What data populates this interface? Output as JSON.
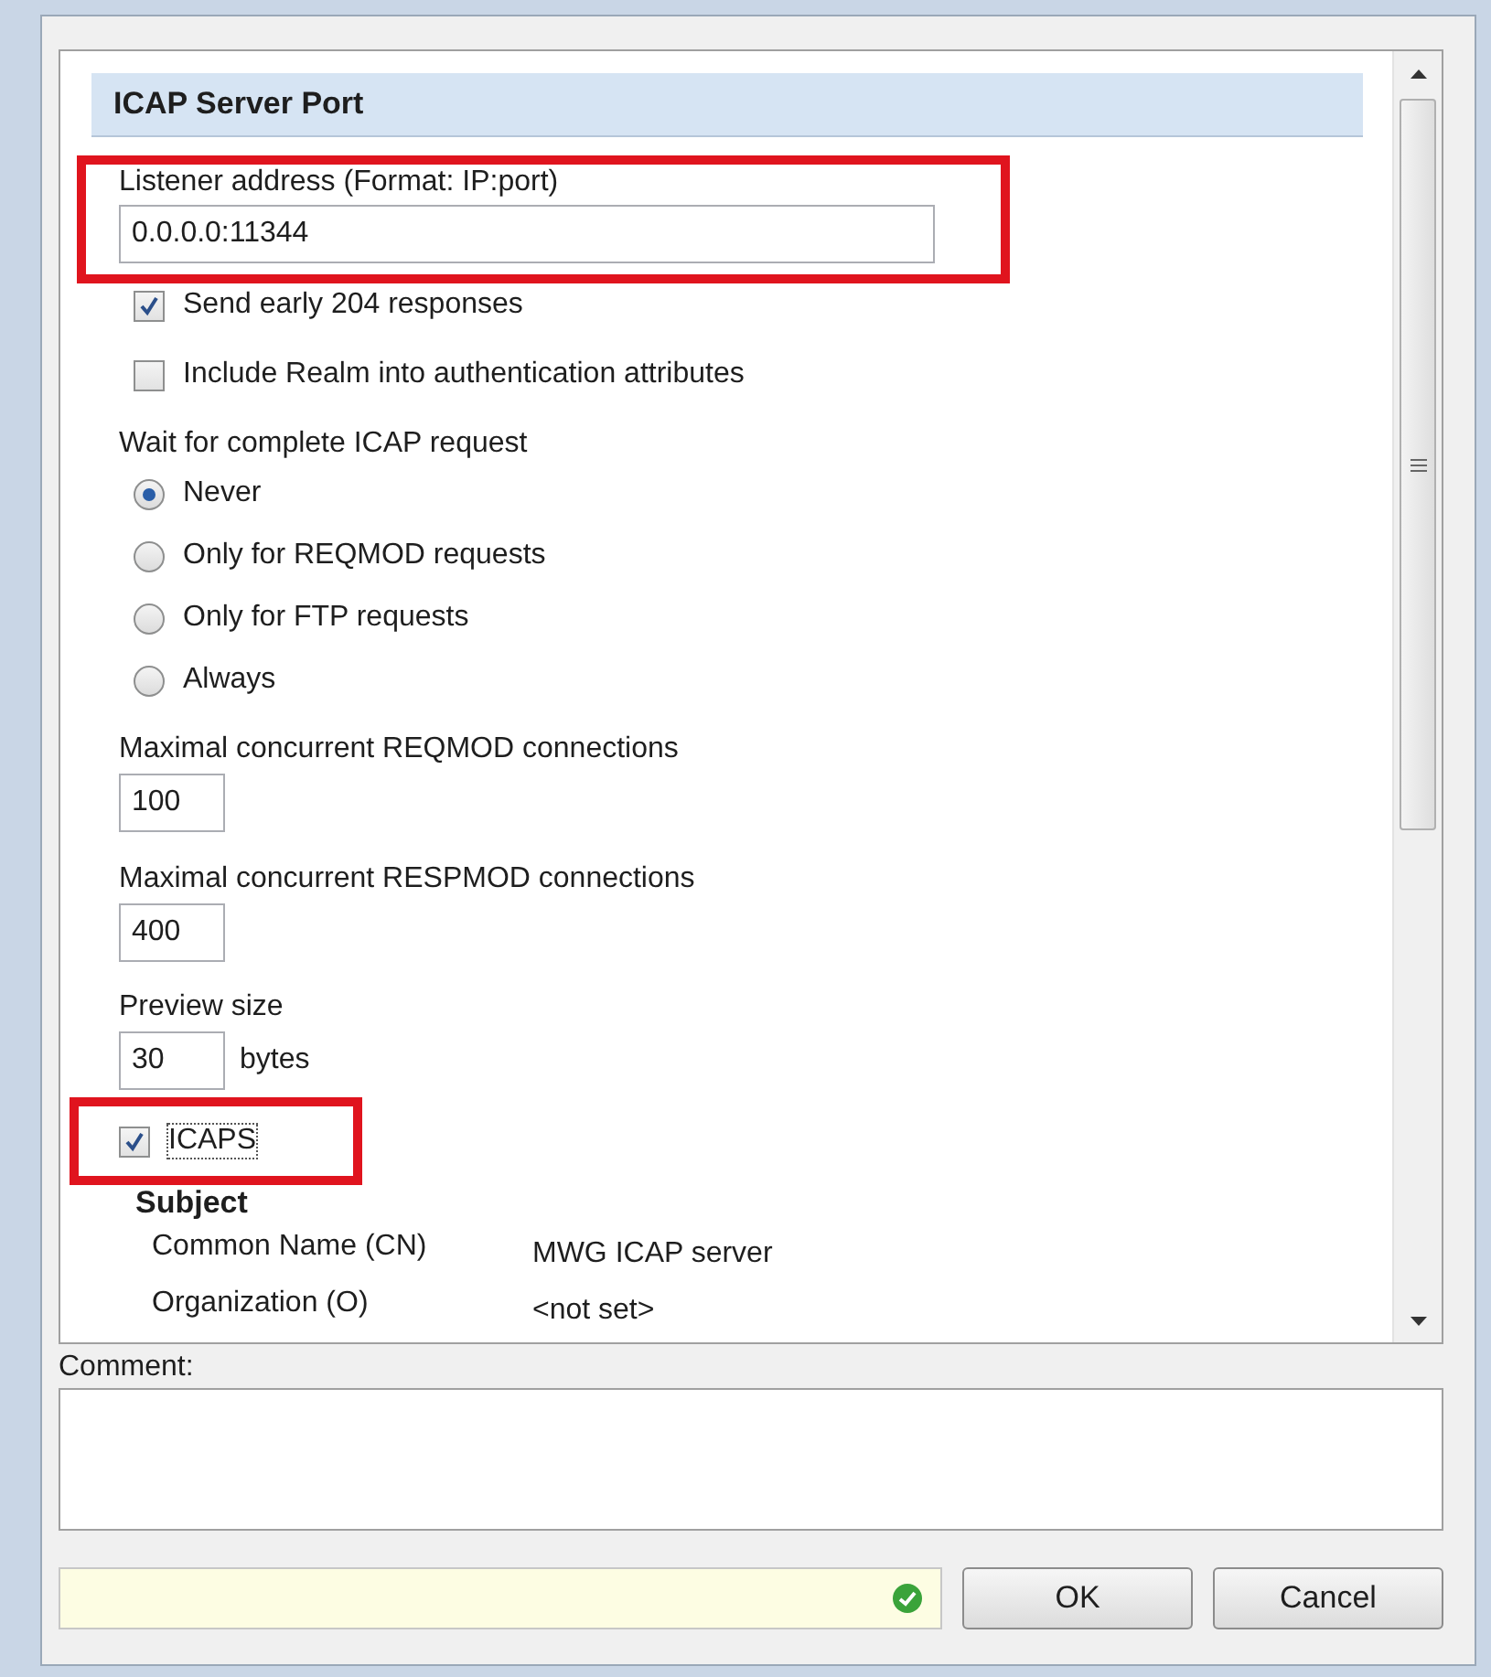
{
  "section": {
    "title": "ICAP Server Port"
  },
  "listener": {
    "label": "Listener address (Format: IP:port)",
    "value": "0.0.0.0:11344",
    "highlighted": true
  },
  "options": [
    {
      "label": "Send early 204 responses",
      "checked": true
    },
    {
      "label": "Include Realm into authentication attributes",
      "checked": false
    }
  ],
  "wait": {
    "label": "Wait for complete ICAP request",
    "options": [
      {
        "label": "Never",
        "selected": true
      },
      {
        "label": "Only for REQMOD requests",
        "selected": false
      },
      {
        "label": "Only for FTP requests",
        "selected": false
      },
      {
        "label": "Always",
        "selected": false
      }
    ]
  },
  "limits": [
    {
      "label": "Maximal concurrent REQMOD connections",
      "value": "100"
    },
    {
      "label": "Maximal concurrent RESPMOD connections",
      "value": "400"
    }
  ],
  "preview": {
    "label": "Preview size",
    "value": "30",
    "unit": "bytes"
  },
  "icaps": {
    "label": "ICAPS",
    "checked": true,
    "highlighted": true
  },
  "subject": {
    "title": "Subject",
    "rows": [
      {
        "name": "Common Name (CN)",
        "value": "MWG ICAP server"
      },
      {
        "name": "Organization (O)",
        "value": "<not set>"
      }
    ]
  },
  "comment": {
    "label": "Comment:"
  },
  "buttons": [
    {
      "label": "OK"
    },
    {
      "label": "Cancel"
    }
  ]
}
